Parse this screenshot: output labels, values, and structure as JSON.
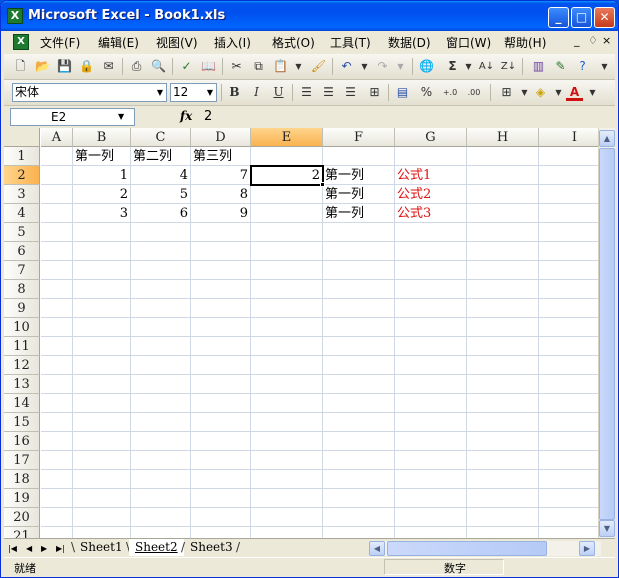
{
  "window": {
    "title": "Microsoft Excel - Book1.xls",
    "controls": {
      "minimize": "_",
      "maximize": "□",
      "close": "✕"
    }
  },
  "menu": {
    "items": [
      "文件(F)",
      "编辑(E)",
      "视图(V)",
      "插入(I)",
      "格式(O)",
      "工具(T)",
      "数据(D)",
      "窗口(W)",
      "帮助(H)"
    ],
    "doc_controls": [
      "_",
      "♢",
      "×"
    ]
  },
  "format_toolbar": {
    "font_name": "宋体",
    "font_size": "12",
    "bold": "B",
    "italic": "I",
    "underline": "U",
    "percent": "%",
    "inc_decimal": "+.0",
    "dec_decimal": ".00"
  },
  "formula_bar": {
    "name_box": "E2",
    "fx": "fx",
    "formula": "2"
  },
  "grid": {
    "columns": [
      "A",
      "B",
      "C",
      "D",
      "E",
      "F",
      "G",
      "H",
      "I"
    ],
    "active_column": "E",
    "rows": [
      "1",
      "2",
      "3",
      "4",
      "5",
      "6",
      "7",
      "8",
      "9",
      "10",
      "11",
      "12",
      "13",
      "14",
      "15",
      "16",
      "17",
      "18",
      "19",
      "20",
      "21"
    ],
    "active_row": "2",
    "cells": {
      "B1": "第一列",
      "C1": "第二列",
      "D1": "第三列",
      "B2": "1",
      "C2": "4",
      "D2": "7",
      "E2": "2",
      "F2": "第一列",
      "G2": "公式1",
      "B3": "2",
      "C3": "5",
      "D3": "8",
      "F3": "第一列",
      "G3": "公式2",
      "B4": "3",
      "C4": "6",
      "D4": "9",
      "F4": "第一列",
      "G4": "公式3"
    },
    "formula_text_color": "#e01010",
    "selected_cell": "E2"
  },
  "sheet_tabs": {
    "tabs": [
      "Sheet1",
      "Sheet2",
      "Sheet3"
    ],
    "active": "Sheet2",
    "nav": [
      "|◀",
      "◀",
      "▶",
      "▶|"
    ]
  },
  "status_bar": {
    "ready": "就绪",
    "mode": "数字"
  },
  "colors": {
    "title_bar": "#0058ee",
    "active_header": "#f9b24e",
    "gridline": "#d0d7e5",
    "chrome": "#ece9d8"
  }
}
